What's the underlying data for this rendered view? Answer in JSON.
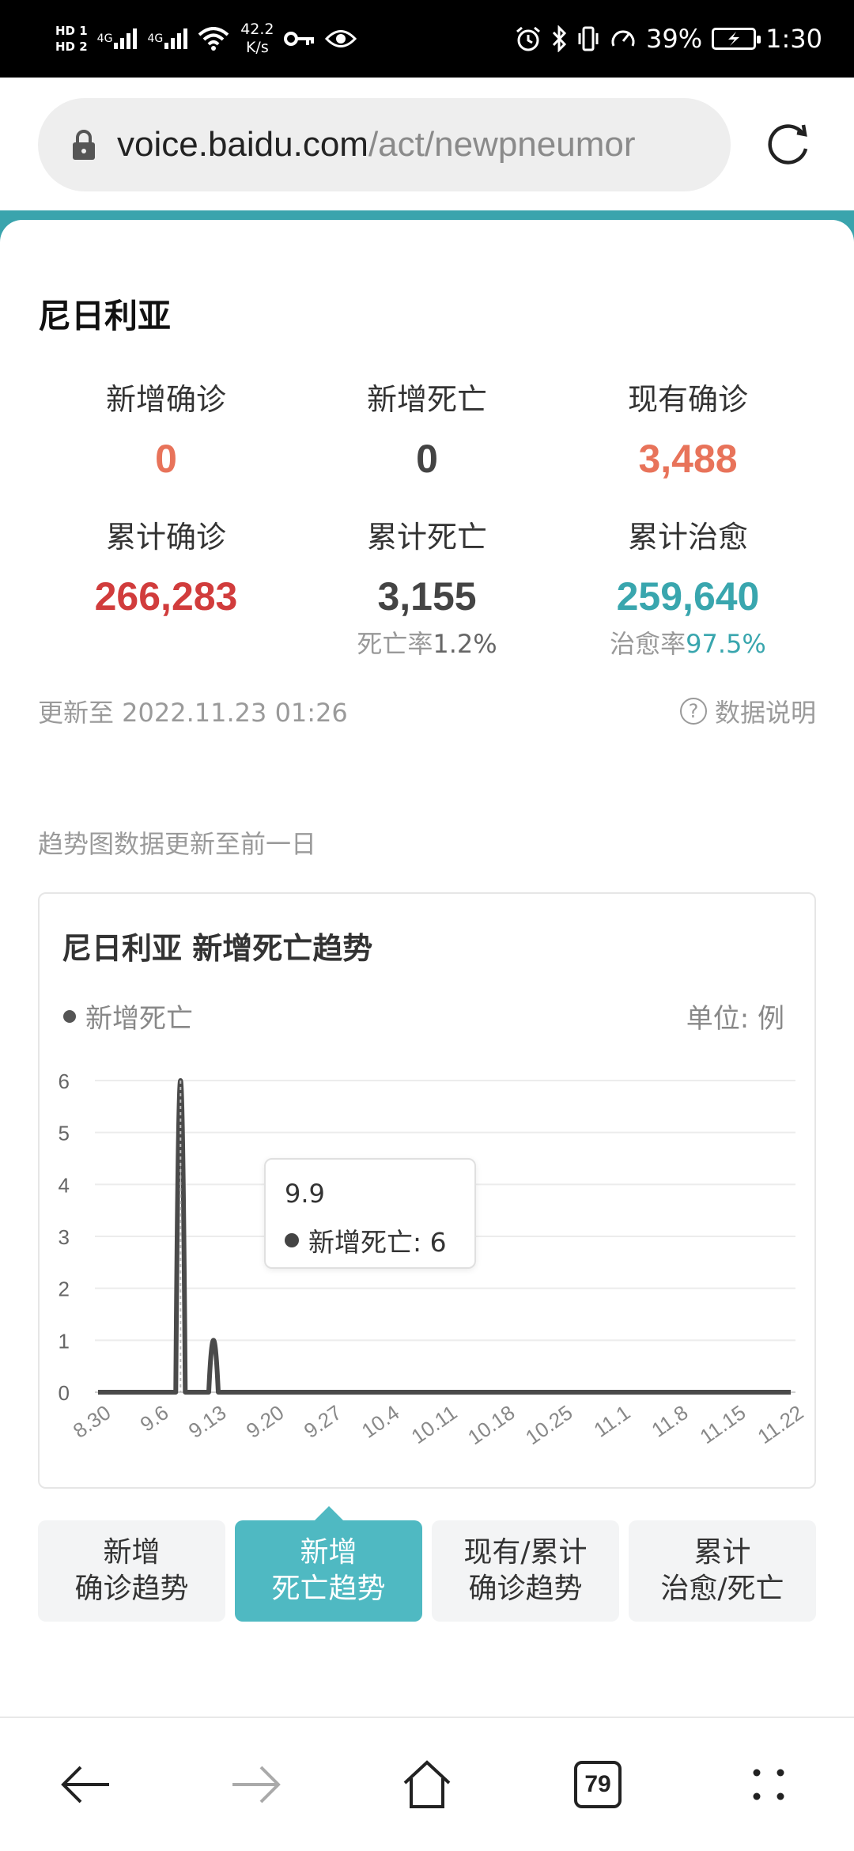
{
  "status_bar": {
    "hd1": "HD 1",
    "hd2": "HD 2",
    "net1": "4G",
    "net2": "4G",
    "speed_value": "42.2",
    "speed_unit": "K/s",
    "battery_pct": "39%",
    "time": "1:30"
  },
  "browser": {
    "url_host": "voice.baidu.com",
    "url_path": "/act/newpneumor",
    "tab_count": "79"
  },
  "country": "尼日利亚",
  "stats": {
    "new_confirmed": {
      "label": "新增确诊",
      "value": "0"
    },
    "new_deaths": {
      "label": "新增死亡",
      "value": "0"
    },
    "current_confirmed": {
      "label": "现有确诊",
      "value": "3,488"
    },
    "total_confirmed": {
      "label": "累计确诊",
      "value": "266,283"
    },
    "total_deaths": {
      "label": "累计死亡",
      "value": "3,155",
      "rate_label": "死亡率",
      "rate_value": "1.2%"
    },
    "total_recovered": {
      "label": "累计治愈",
      "value": "259,640",
      "rate_label": "治愈率",
      "rate_value": "97.5%"
    }
  },
  "update_time": "更新至 2022.11.23 01:26",
  "data_note": "数据说明",
  "trend_note": "趋势图数据更新至前一日",
  "chart": {
    "title": "尼日利亚 新增死亡趋势",
    "legend": "新增死亡",
    "unit": "单位: 例",
    "tooltip_date": "9.9",
    "tooltip_label": "新增死亡: 6"
  },
  "chart_data": {
    "type": "line",
    "series": [
      {
        "name": "新增死亡",
        "x": [
          "8.30",
          "9.6",
          "9.9",
          "9.13",
          "9.20",
          "9.27",
          "10.4",
          "10.11",
          "10.18",
          "10.25",
          "11.1",
          "11.8",
          "11.15",
          "11.22"
        ],
        "values": [
          0,
          0,
          6,
          1,
          0,
          0,
          0,
          0,
          0,
          0,
          0,
          0,
          0,
          0
        ]
      }
    ],
    "x_tick_labels": [
      "8.30",
      "9.6",
      "9.13",
      "9.20",
      "9.27",
      "10.4",
      "10.11",
      "10.18",
      "10.25",
      "11.1",
      "11.8",
      "11.15",
      "11.22"
    ],
    "y_tick_labels": [
      "0",
      "1",
      "2",
      "3",
      "4",
      "5",
      "6"
    ],
    "ylim": [
      0,
      6
    ],
    "grid": true,
    "legend_position": "top-left"
  },
  "tabs": [
    {
      "line1": "新增",
      "line2": "确诊趋势"
    },
    {
      "line1": "新增",
      "line2": "死亡趋势"
    },
    {
      "line1": "现有/累计",
      "line2": "确诊趋势"
    },
    {
      "line1": "累计",
      "line2": "治愈/死亡"
    }
  ],
  "colors": {
    "accent_teal": "#3aa4ad",
    "active_tab": "#4fb9c2",
    "orange": "#e8735a",
    "red": "#d13c3c",
    "line": "#555555"
  },
  "icons": [
    "alarm-icon",
    "bluetooth-icon",
    "vibrate-icon",
    "speedometer-icon",
    "wifi-icon",
    "key-icon",
    "eye-icon",
    "lock-icon",
    "refresh-icon",
    "back-icon",
    "forward-icon",
    "home-icon",
    "menu-icon",
    "help-icon"
  ]
}
